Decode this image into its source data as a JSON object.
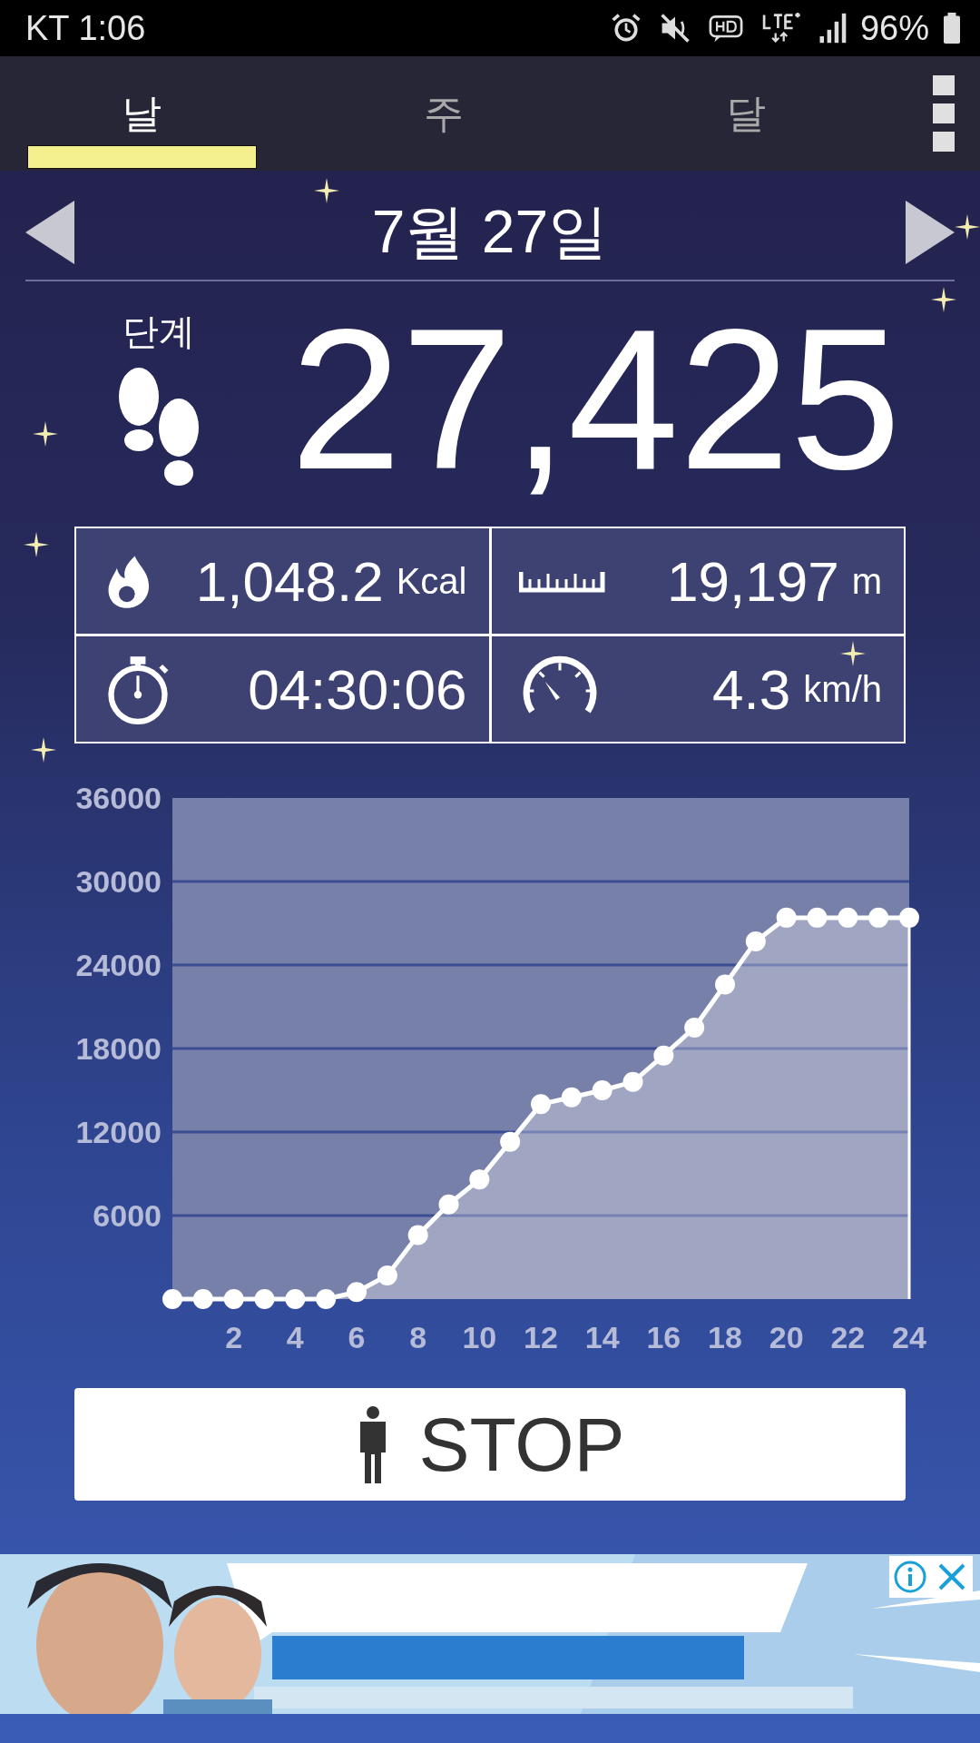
{
  "status_bar": {
    "carrier_time": "KT 1:06",
    "battery": "96%"
  },
  "tabs": [
    {
      "label": "날",
      "selected": true
    },
    {
      "label": "주",
      "selected": false
    },
    {
      "label": "달",
      "selected": false
    }
  ],
  "date": "7월 27일",
  "steps": {
    "label": "단계",
    "value": "27,425"
  },
  "stats": [
    {
      "kind": "calories",
      "value": "1,048.2",
      "unit": "Kcal"
    },
    {
      "kind": "distance",
      "value": "19,197",
      "unit": "m"
    },
    {
      "kind": "time",
      "value": "04:30:06"
    },
    {
      "kind": "speed",
      "value": "4.3",
      "unit": "km/h"
    }
  ],
  "chart_data": {
    "type": "area",
    "x": [
      0,
      1,
      2,
      3,
      4,
      5,
      6,
      7,
      8,
      9,
      10,
      11,
      12,
      13,
      14,
      15,
      16,
      17,
      18,
      19,
      20,
      21,
      22,
      23,
      24
    ],
    "xlim": [
      0,
      24
    ],
    "ylim": [
      0,
      36000
    ],
    "xticks": [
      2,
      4,
      6,
      8,
      10,
      12,
      14,
      16,
      18,
      20,
      22,
      24
    ],
    "yticks": [
      6000,
      12000,
      18000,
      24000,
      30000,
      36000
    ],
    "grid": true,
    "series": [
      {
        "color": "#ffffff",
        "values": [
          0,
          0,
          0,
          0,
          0,
          0,
          500,
          1700,
          4600,
          6800,
          8600,
          11300,
          14000,
          14500,
          15000,
          15600,
          17500,
          19500,
          22600,
          25700,
          27400,
          27400,
          27400,
          27400,
          27400
        ]
      }
    ]
  },
  "stop_button": {
    "label": "STOP"
  }
}
